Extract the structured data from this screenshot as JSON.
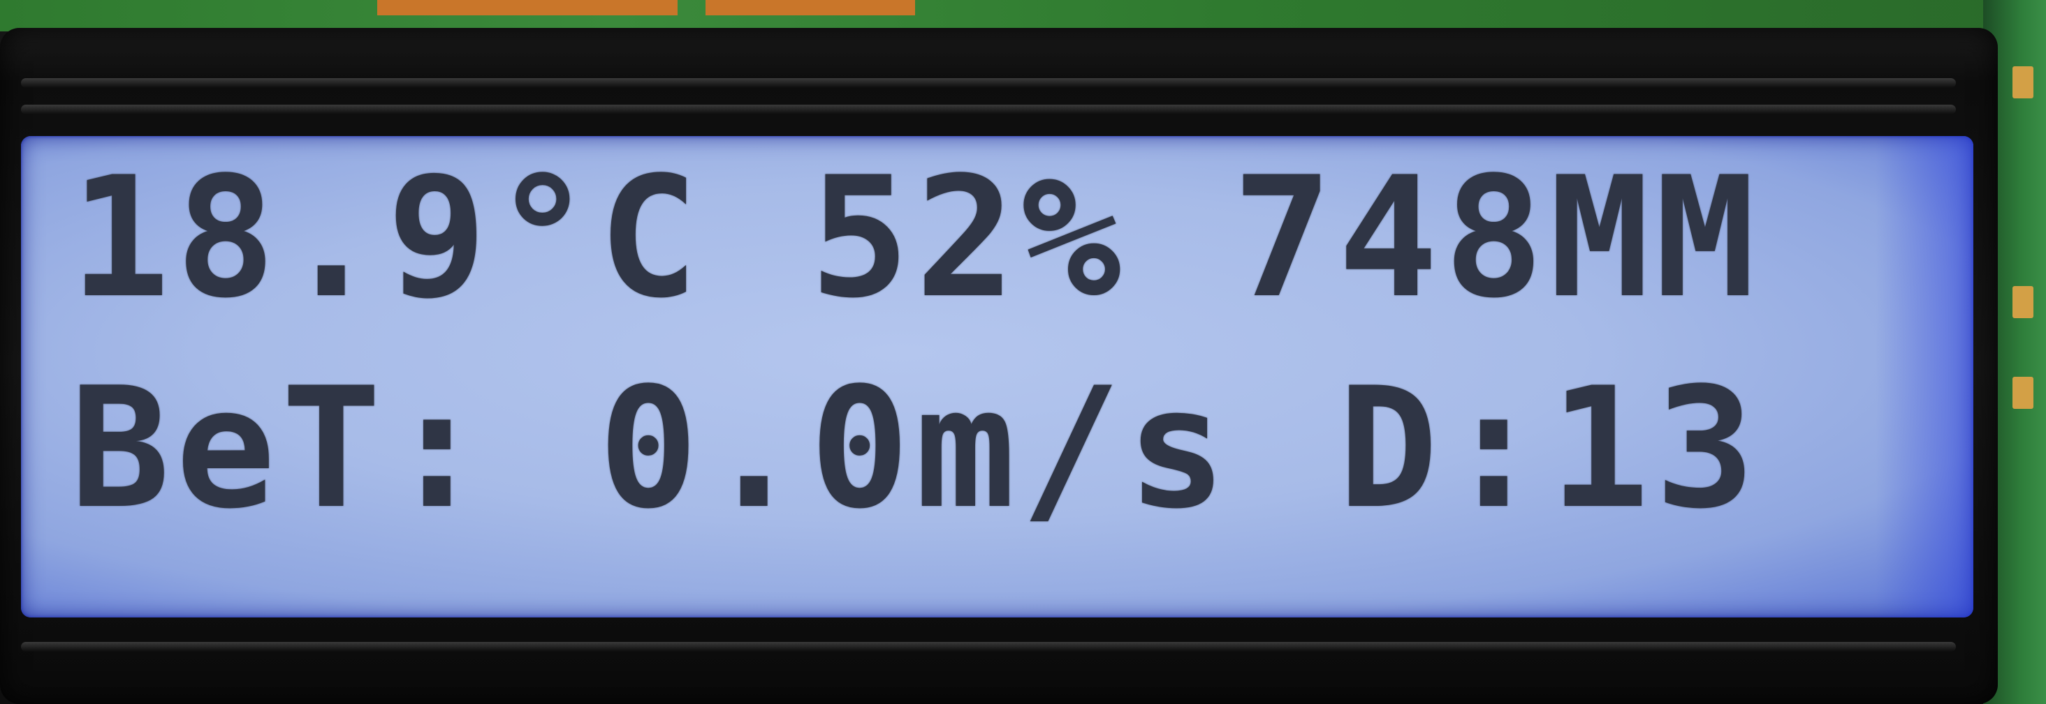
{
  "display": {
    "line1": "18.9°C 52% 748MM",
    "line2": "BeT: 0.0m/s D:13"
  },
  "colors": {
    "lcd_background": "#a7bbe8",
    "lcd_text": "#2f3545",
    "bezel": "#151515",
    "pcb": "#2f7a2f"
  }
}
